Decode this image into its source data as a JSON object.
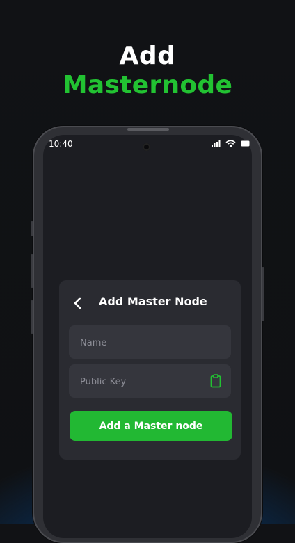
{
  "headline": {
    "line1": "Add",
    "line2": "Masternode"
  },
  "status_bar": {
    "time": "10:40",
    "icons": [
      "signal-icon",
      "wifi-icon",
      "battery-icon"
    ]
  },
  "card": {
    "title": "Add Master Node",
    "name_placeholder": "Name",
    "public_key_placeholder": "Public Key",
    "submit_label": "Add a Master node"
  },
  "colors": {
    "accent": "#22c232",
    "button": "#22b833",
    "card": "#2a2b31",
    "field": "#35363d"
  }
}
